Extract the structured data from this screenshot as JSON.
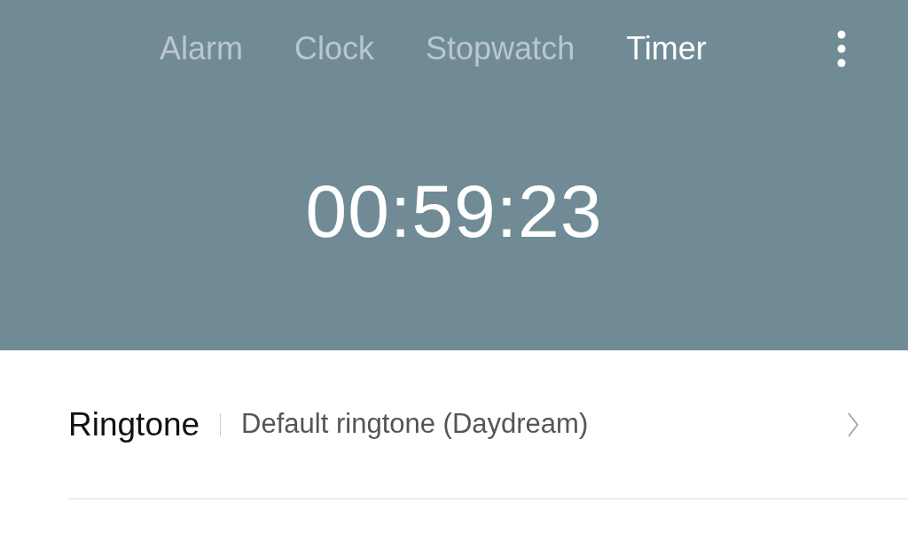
{
  "tabs": [
    {
      "label": "Alarm",
      "selected": false
    },
    {
      "label": "Clock",
      "selected": false
    },
    {
      "label": "Stopwatch",
      "selected": false
    },
    {
      "label": "Timer",
      "selected": true
    }
  ],
  "timer": {
    "time": "00:59:23"
  },
  "settings": [
    {
      "label": "Ringtone",
      "value": "Default ringtone (Daydream)"
    }
  ]
}
